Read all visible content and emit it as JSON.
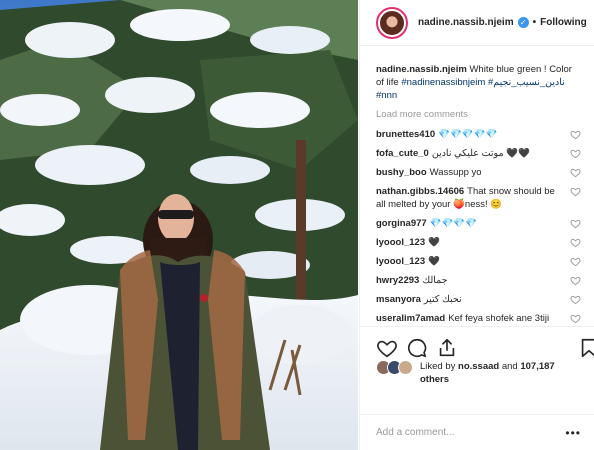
{
  "post": {
    "username": "nadine.nassib.njeim",
    "verified_glyph": "✓",
    "dot": "•",
    "follow_status": "Following",
    "caption_user": "nadine.nassib.njeim",
    "caption_text": "White blue green ! Color of life",
    "caption_tags": [
      "#nadinenassibnjeim",
      "#نادين_نسيب_نجيم",
      "#nnn"
    ],
    "load_more": "Load more comments",
    "comments": [
      {
        "user": "brunettes410",
        "text": "💎💎💎💎💎"
      },
      {
        "user": "fofa_cute_0",
        "text": "موتت عليكي نادين 🖤🖤"
      },
      {
        "user": "bushy_boo",
        "text": "Wassupp yo"
      },
      {
        "user": "nathan.gibbs.14606",
        "text": "That snow should be all melted by your 🍑ness! 😊"
      },
      {
        "user": "gorgina977",
        "text": "💎💎💎💎"
      },
      {
        "user": "lyoool_123",
        "text": "🖤"
      },
      {
        "user": "lyoool_123",
        "text": "🖤"
      },
      {
        "user": "hwry2293",
        "text": "جمالك"
      },
      {
        "user": "msanyora",
        "text": "نحبك كتير"
      },
      {
        "user": "useralim7amad",
        "text": "Kef feya shofek ane 3tiji btmana"
      }
    ],
    "liked_by_prefix": "Liked by",
    "liked_by_user": "no.ssaad",
    "liked_and": "and",
    "others_count": "107,187 others",
    "add_comment_placeholder": "Add a comment...",
    "more_glyph": "•••"
  },
  "colors": {
    "accent_link": "#003569",
    "verified_blue": "#3897f0",
    "story_ring": "#e1306c"
  },
  "icons": [
    "heart-icon",
    "comment-icon",
    "share-icon",
    "bookmark-icon",
    "verified-icon",
    "more-icon"
  ]
}
